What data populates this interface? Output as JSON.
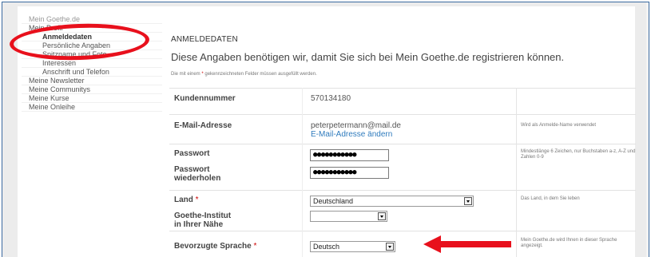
{
  "sidebar": {
    "items": [
      {
        "label": "Mein Goethe.de",
        "level": "top"
      },
      {
        "label": "Mein Profil",
        "level": "main"
      },
      {
        "label": "Anmeldedaten",
        "level": "sub-active"
      },
      {
        "label": "Persönliche Angaben",
        "level": "sub"
      },
      {
        "label": "Spitzname und Foto",
        "level": "sub"
      },
      {
        "label": "Interessen",
        "level": "sub"
      },
      {
        "label": "Anschrift und Telefon",
        "level": "sub"
      },
      {
        "label": "Meine Newsletter",
        "level": "main"
      },
      {
        "label": "Meine Communitys",
        "level": "main"
      },
      {
        "label": "Meine Kurse",
        "level": "main"
      },
      {
        "label": "Meine Onleihe",
        "level": "main"
      }
    ]
  },
  "main": {
    "section_title": "ANMELDEDATEN",
    "intro": "Diese Angaben benötigen wir, damit Sie sich bei Mein Goethe.de registrieren können.",
    "required_note_before": "Die mit einem ",
    "required_star": "*",
    "required_note_after": " gekennzeichneten Felder müssen ausgefüllt werden.",
    "fields": {
      "customer_number": {
        "label": "Kundennummer",
        "value": "570134180"
      },
      "email": {
        "label": "E-Mail-Adresse",
        "value": "peterpetermann@mail.de",
        "link": "E-Mail-Adresse ändern",
        "hint": "Wird als Anmelde-Name verwendet"
      },
      "password": {
        "label": "Passwort",
        "value": "●●●●●●●●●●●",
        "hint": "Mindestlänge 6 Zeichen, nur Buchstaben a-z, A-Z und Zahlen 0-9"
      },
      "password_repeat": {
        "label_line1": "Passwort",
        "label_line2": "wiederholen",
        "value": "●●●●●●●●●●●"
      },
      "country": {
        "label": "Land",
        "required": "*",
        "value": "Deutschland",
        "hint": "Das Land, in dem Sie leben"
      },
      "goethe_institut": {
        "label_line1": "Goethe-Institut",
        "label_line2": "in Ihrer Nähe",
        "value": ""
      },
      "language": {
        "label": "Bevorzugte Sprache",
        "required": "*",
        "value": "Deutsch",
        "hint": "Mein Goethe.de wird Ihnen in dieser Sprache angezeigt."
      }
    }
  },
  "annotations": {
    "circle_color": "#e8101c",
    "arrow_color": "#e8101c"
  }
}
